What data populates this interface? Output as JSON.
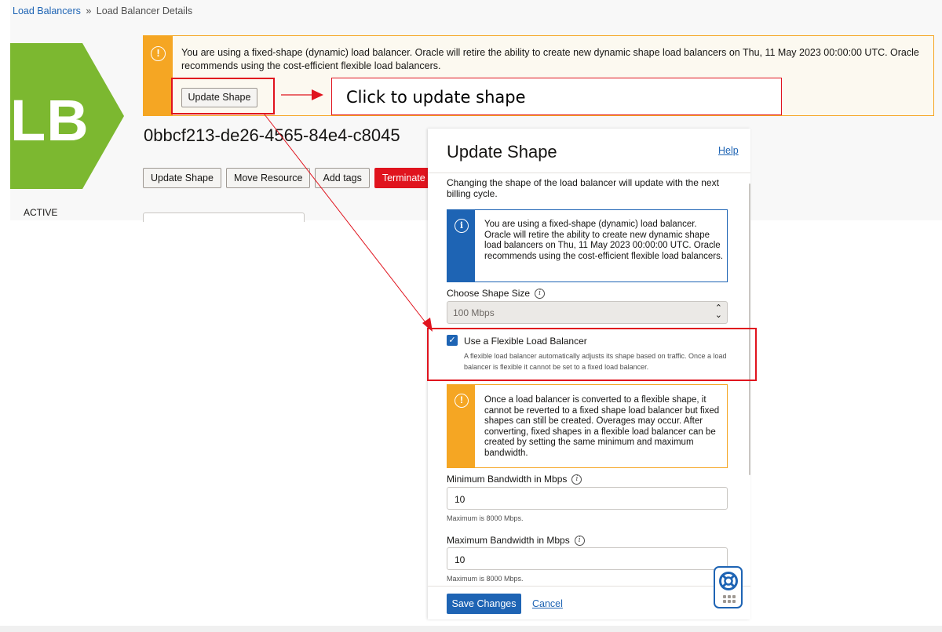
{
  "breadcrumb": {
    "root": "Load Balancers",
    "separator": "»",
    "current": "Load Balancer Details"
  },
  "logo": {
    "text": "LB",
    "color": "#7cb830"
  },
  "status": "ACTIVE",
  "banner": {
    "icon": "warning-icon",
    "text": "You are using a fixed-shape (dynamic) load balancer. Oracle will retire the ability to create new dynamic shape load balancers on Thu, 11 May 2023 00:00:00 UTC. Oracle recommends using the cost-efficient flexible load balancers.",
    "button": "Update Shape"
  },
  "annotation": {
    "text": "Click to update shape"
  },
  "resource_id": "0bbcf213-de26-4565-84e4-c8045",
  "actions": {
    "update_shape": "Update Shape",
    "move_resource": "Move Resource",
    "add_tags": "Add tags",
    "terminate": "Terminate"
  },
  "panel": {
    "title": "Update Shape",
    "help": "Help",
    "intro": "Changing the shape of the load balancer will update with the next billing cycle.",
    "info_text": "You are using a fixed-shape (dynamic) load balancer. Oracle will retire the ability to create new dynamic shape load balancers on Thu, 11 May 2023 00:00:00 UTC. Oracle recommends using the cost-efficient flexible load balancers.",
    "shape_label": "Choose Shape Size",
    "shape_value": "100 Mbps",
    "flexible_label": "Use a Flexible Load Balancer",
    "flexible_checked": true,
    "flexible_help": "A flexible load balancer automatically adjusts its shape based on traffic. Once a load balancer is flexible it cannot be set to a fixed load balancer.",
    "warning_text": "Once a load balancer is converted to a flexible shape, it cannot be reverted to a fixed shape load balancer but fixed shapes can still be created. Overages may occur. After converting, fixed shapes in a flexible load balancer can be created by setting the same minimum and maximum bandwidth.",
    "min_label": "Minimum Bandwidth in Mbps",
    "min_value": "10",
    "min_hint": "Maximum is 8000 Mbps.",
    "max_label": "Maximum Bandwidth in Mbps",
    "max_value": "10",
    "max_hint": "Maximum is 8000 Mbps.",
    "save": "Save Changes",
    "cancel": "Cancel"
  },
  "colors": {
    "accent": "#1e64b4",
    "warning": "#f5a623",
    "danger": "#e0141e",
    "annotation": "#e0141e"
  }
}
